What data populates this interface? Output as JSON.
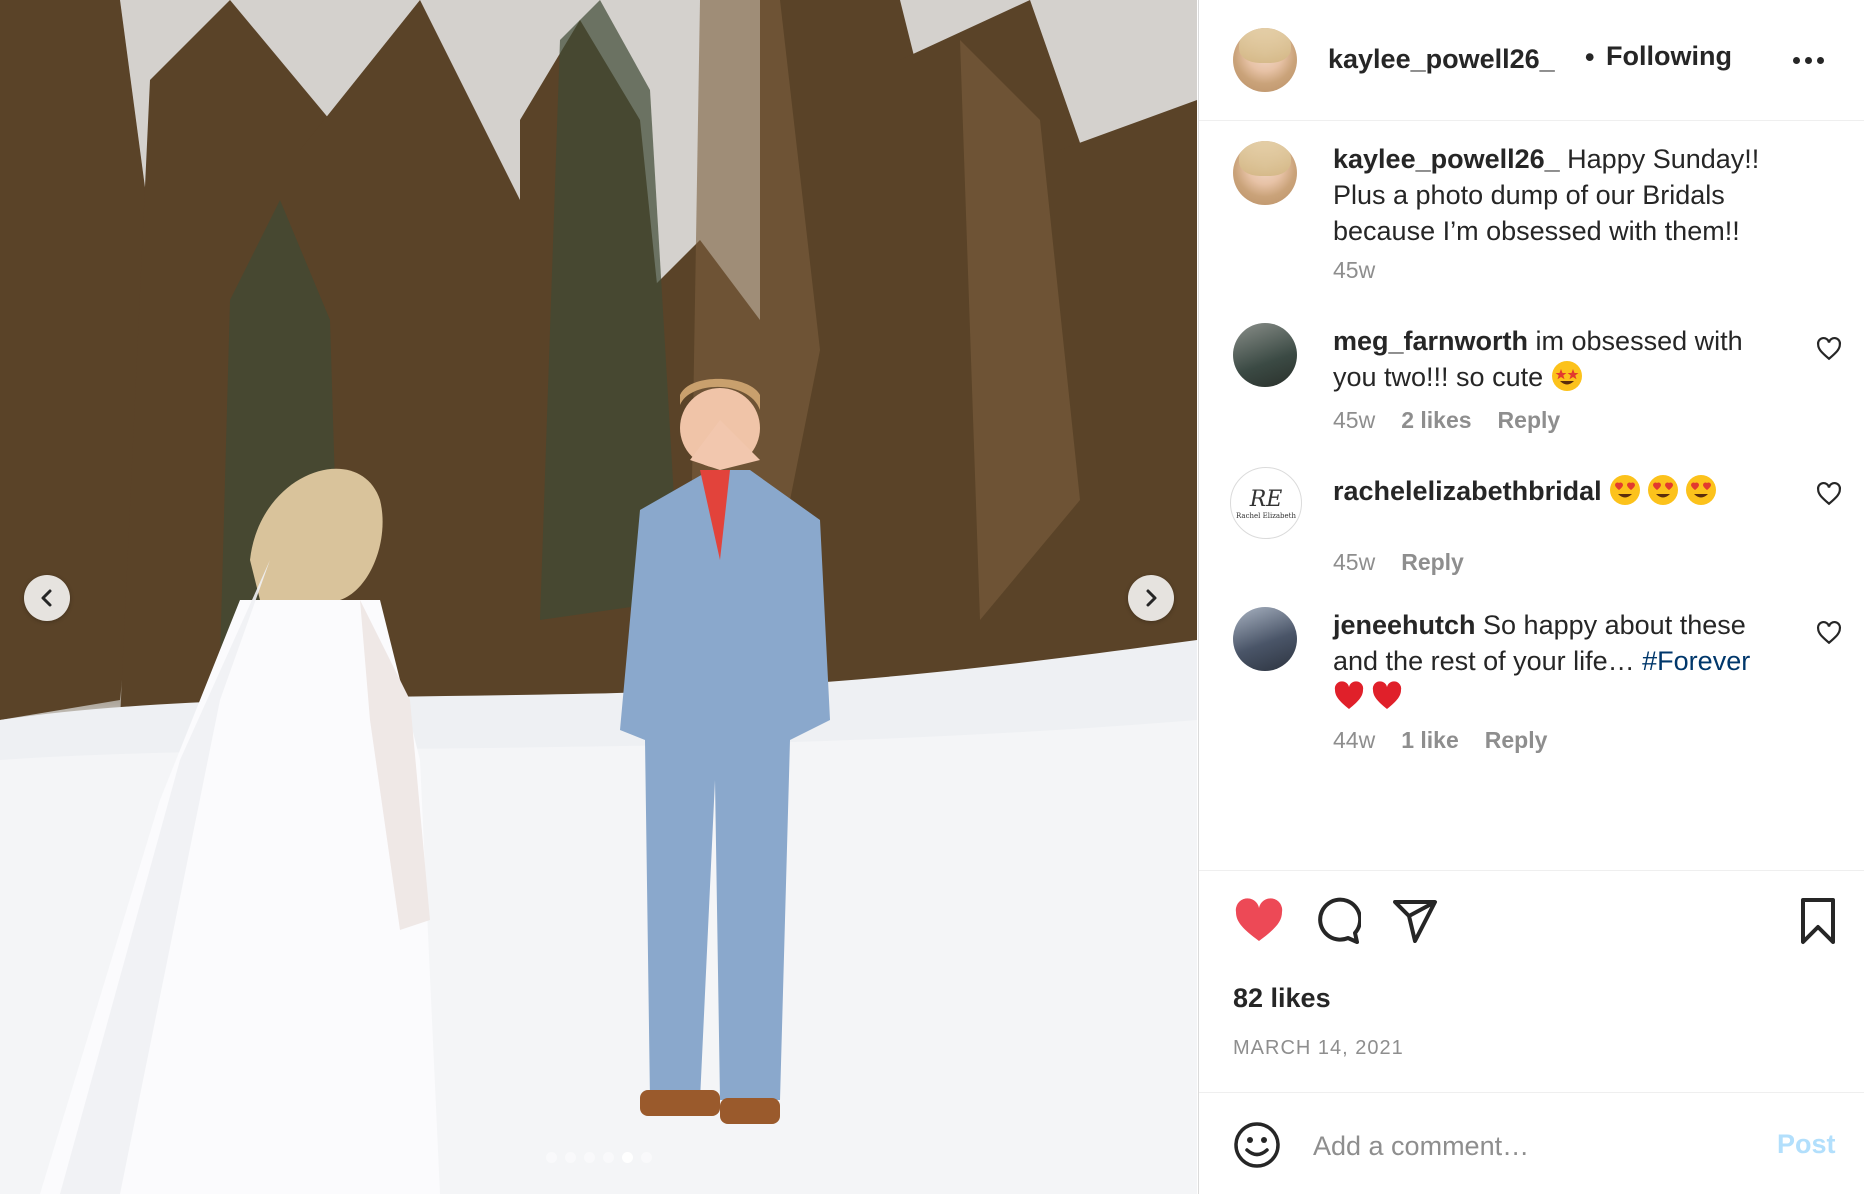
{
  "media": {
    "carousel_total": 6,
    "carousel_active": 5,
    "prev_icon": "chevron-left-icon",
    "next_icon": "chevron-right-icon"
  },
  "header": {
    "username": "kaylee_powell26_",
    "separator": "•",
    "follow_status": "Following",
    "more_icon": "more-horizontal-icon"
  },
  "caption": {
    "username": "kaylee_powell26_",
    "text": " Happy Sunday!! Plus a photo dump of our Bridals because I’m obsessed with them!!",
    "time": "45w"
  },
  "comments": [
    {
      "username": "meg_farnworth",
      "text": " im obsessed with you two!!! so cute ",
      "emoji": "star-struck-emoji",
      "time": "45w",
      "likes": "2 likes",
      "reply": "Reply"
    },
    {
      "username": "rachelelizabethbridal",
      "text": " ",
      "emoji": "heart-eyes-emoji x3",
      "time": "45w",
      "reply": "Reply",
      "avatar_text": "RE",
      "avatar_sub": "Rachel Elizabeth"
    },
    {
      "username": "jeneehutch",
      "text": " So happy about these and the rest of your life… ",
      "hashtag": "#Forever",
      "emoji": "red-heart-emoji x2",
      "time": "44w",
      "likes": "1 like",
      "reply": "Reply"
    }
  ],
  "actions": {
    "like_icon": "heart-filled-icon",
    "like_color": "#ed4956",
    "comment_icon": "comment-icon",
    "share_icon": "paper-plane-icon",
    "save_icon": "bookmark-icon",
    "likes": "82 likes",
    "date": "MARCH 14, 2021"
  },
  "add_comment": {
    "placeholder": "Add a comment…",
    "post_label": "Post",
    "emoji_icon": "smiley-icon",
    "post_color": "#b2dffc"
  }
}
